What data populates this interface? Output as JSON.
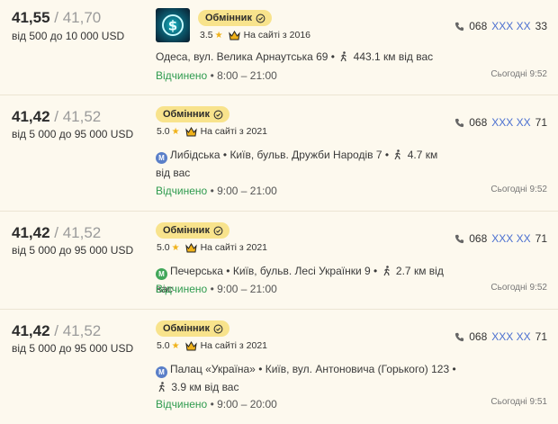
{
  "listings": [
    {
      "buy": "41,55",
      "sell": "41,70",
      "range": "від 500 до 10 000 USD",
      "badge": "Обмінник",
      "rating": "3.5",
      "since": "На сайті з 2016",
      "metro": "",
      "address_a": "Одеса, вул. Велика Арнаутська 69 •",
      "address_b": "443.1 км від вас",
      "status": "Відчинено",
      "hours": " • 8:00 – 21:00",
      "phone_prefix": "068",
      "phone_hidden": "XXX XX",
      "phone_suffix": "33",
      "updated": "Сьогодні 9:52"
    },
    {
      "buy": "41,42",
      "sell": "41,52",
      "range": "від 5 000 до 95 000 USD",
      "badge": "Обмінник",
      "rating": "5.0",
      "since": "На сайті з 2021",
      "metro": "Либідська",
      "address_a": "• Київ, бульв. Дружби Народів 7 •",
      "address_b": "4.7 км від вас",
      "status": "Відчинено",
      "hours": " • 9:00 – 21:00",
      "phone_prefix": "068",
      "phone_hidden": "XXX XX",
      "phone_suffix": "71",
      "updated": "Сьогодні 9:52"
    },
    {
      "buy": "41,42",
      "sell": "41,52",
      "range": "від 5 000 до 95 000 USD",
      "badge": "Обмінник",
      "rating": "5.0",
      "since": "На сайті з 2021",
      "metro": "Печерська",
      "address_a": "• Київ, бульв. Лесі Українки 9 •",
      "address_b": "2.7 км від вас",
      "status": "Відчинено",
      "hours": " • 9:00 – 21:00",
      "phone_prefix": "068",
      "phone_hidden": "XXX XX",
      "phone_suffix": "71",
      "updated": "Сьогодні 9:52"
    },
    {
      "buy": "41,42",
      "sell": "41,52",
      "range": "від 5 000 до 95 000 USD",
      "badge": "Обмінник",
      "rating": "5.0",
      "since": "На сайті з 2021",
      "metro": "Палац «Україна»",
      "address_a": "• Київ, вул. Антоновича (Горького) 123 •",
      "address_b": "3.9 км від вас",
      "status": "Відчинено",
      "hours": " • 9:00 – 20:00",
      "phone_prefix": "068",
      "phone_hidden": "XXX XX",
      "phone_suffix": "71",
      "updated": "Сьогодні 9:51"
    }
  ],
  "separator": " / ",
  "colors": {
    "background": "#fdf9ee",
    "badge": "#f8e38c",
    "open": "#2f9b4f",
    "phone_hidden": "#4a6fd0",
    "star": "#f0b21a",
    "metro_blue": "#5a7fc8",
    "metro_green": "#42a75a"
  },
  "icons": {
    "verified": "check-circle-icon",
    "star": "star-icon",
    "crown": "crown-icon",
    "metro": "metro-icon",
    "walk": "walking-icon",
    "phone": "phone-icon",
    "logo": "dollar-logo-icon"
  }
}
